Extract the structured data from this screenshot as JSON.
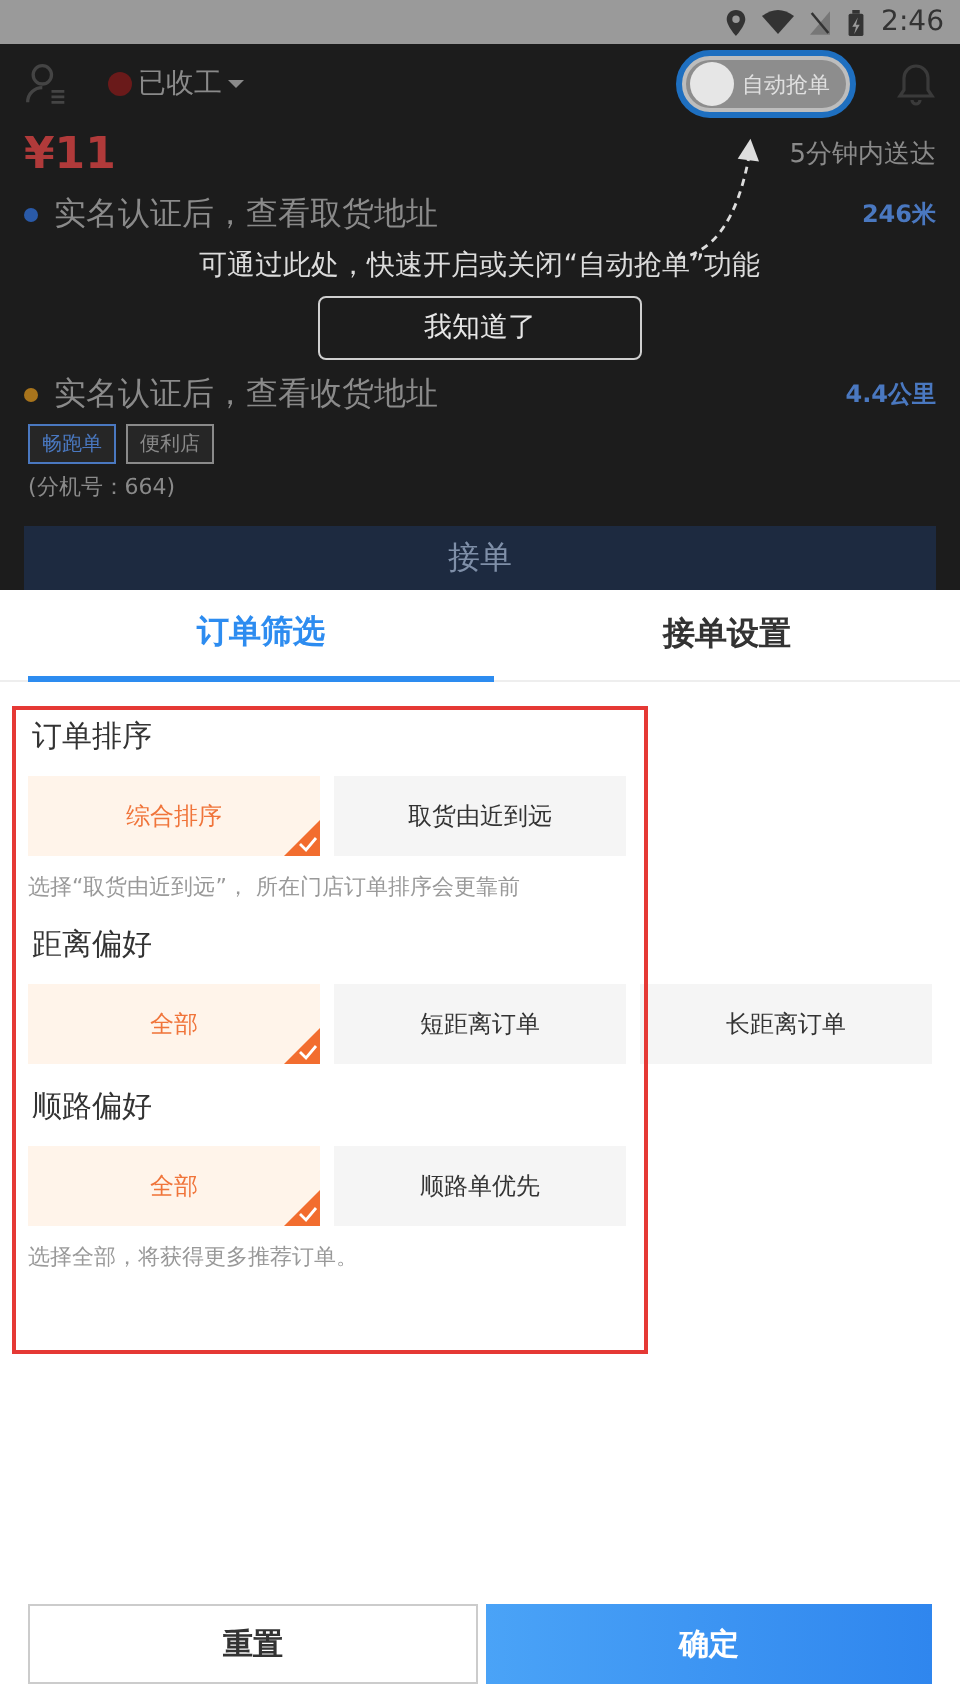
{
  "status_bar": {
    "time": "2:46"
  },
  "header": {
    "status": "已收工",
    "auto_grab": {
      "label": "自动抢单",
      "on": false
    }
  },
  "background_order": {
    "price": "¥11",
    "eta": "5分钟内送达",
    "stops": [
      {
        "text": "实名认证后，查看取货地址",
        "distance": "246米",
        "color": "#2a5aa8"
      },
      {
        "text": "实名认证后，查看收货地址",
        "distance": "4.4公里",
        "color": "#a8741c"
      }
    ],
    "tags": [
      {
        "label": "畅跑单",
        "color": "#4a78c0"
      },
      {
        "label": "便利店",
        "color": "#8a8a8a"
      }
    ],
    "note": "(分机号：664)",
    "button": "接单"
  },
  "guide": {
    "message": "可通过此处，快速开启或关闭“自动抢单”功能",
    "button": "我知道了"
  },
  "tabs": [
    {
      "label": "订单筛选",
      "selected": true
    },
    {
      "label": "接单设置",
      "selected": false
    }
  ],
  "sections": [
    {
      "title": "订单排序",
      "options": [
        {
          "label": "综合排序",
          "selected": true
        },
        {
          "label": "取货由近到远",
          "selected": false
        }
      ],
      "hint": "选择“取货由近到远”， 所在门店订单排序会更靠前"
    },
    {
      "title": "距离偏好",
      "options": [
        {
          "label": "全部",
          "selected": true
        },
        {
          "label": "短距离订单",
          "selected": false
        },
        {
          "label": "长距离订单",
          "selected": false
        }
      ]
    },
    {
      "title": "顺路偏好",
      "options": [
        {
          "label": "全部",
          "selected": true
        },
        {
          "label": "顺路单优先",
          "selected": false
        }
      ],
      "hint": "选择全部，将获得更多推荐订单。"
    }
  ],
  "footer": {
    "reset": "重置",
    "confirm": "确定"
  }
}
